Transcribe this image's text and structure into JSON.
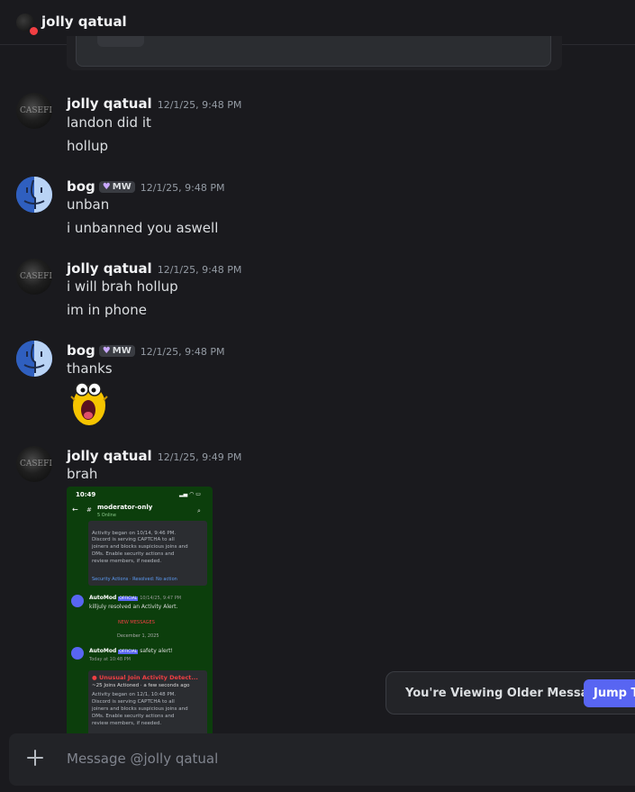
{
  "header": {
    "title": "jolly qatual",
    "status_icon": "dnd-status"
  },
  "messages": [
    {
      "author": "jolly qatual",
      "timestamp": "12/1/25, 9:48 PM",
      "lines": [
        "landon did it",
        "hollup"
      ],
      "avatar": "jolly-avatar"
    },
    {
      "author": "bog",
      "tag": "MW",
      "timestamp": "12/1/25, 9:48 PM",
      "lines": [
        "unban",
        "i unbanned you aswell"
      ],
      "avatar": "finder-avatar"
    },
    {
      "author": "jolly qatual",
      "timestamp": "12/1/25, 9:48 PM",
      "lines": [
        "i will brah hollup",
        "im in phone"
      ],
      "avatar": "jolly-avatar"
    },
    {
      "author": "bog",
      "tag": "MW",
      "timestamp": "12/1/25, 9:48 PM",
      "lines": [
        "thanks"
      ],
      "sticker": "screaming-cat-sticker",
      "avatar": "finder-avatar"
    },
    {
      "author": "jolly qatual",
      "timestamp": "12/1/25, 9:49 PM",
      "lines": [
        "brah"
      ],
      "attachment": "phone-screenshot",
      "avatar": "jolly-avatar"
    }
  ],
  "avatar_text": "CASEFILE",
  "screenshot": {
    "time": "10:49",
    "channel": "moderator-only",
    "online": "5 Online",
    "card1_lines": [
      "Activity began on 10/14, 9:46 PM.",
      "Discord is serving CAPTCHA to all",
      "joiners and blocks suspicious joins and",
      "DMs. Enable security actions and",
      "review members, if needed."
    ],
    "card1_footer": "Security Actions · Resolved: No action",
    "automod1_name": "AutoMod",
    "automod1_badge": "OFFICIAL",
    "automod1_time": "10/14/25, 9:47 PM",
    "automod1_text": "killjuly resolved an Activity Alert.",
    "new_messages": "NEW MESSAGES",
    "date_divider": "December 1, 2025",
    "automod2_name": "AutoMod",
    "automod2_badge": "OFFICIAL",
    "automod2_text": "safety alert!",
    "automod2_time": "Today at 10:48 PM",
    "alert_title": "Unusual Join Activity Detect...",
    "alert_sub": "~25 Joins Actioned · a few seconds ago",
    "card2_lines": [
      "Activity began on 12/1, 10:48 PM.",
      "Discord is serving CAPTCHA to all",
      "joiners and blocks suspicious joins and",
      "DMs. Enable security actions and",
      "review members, if needed."
    ]
  },
  "toast": {
    "text": "You're Viewing Older Messages",
    "button": "Jump To Present"
  },
  "composer": {
    "placeholder": "Message @jolly qatual"
  },
  "colors": {
    "background": "#1a1a1e",
    "accent": "#5865f2",
    "dnd": "#f23f43"
  }
}
